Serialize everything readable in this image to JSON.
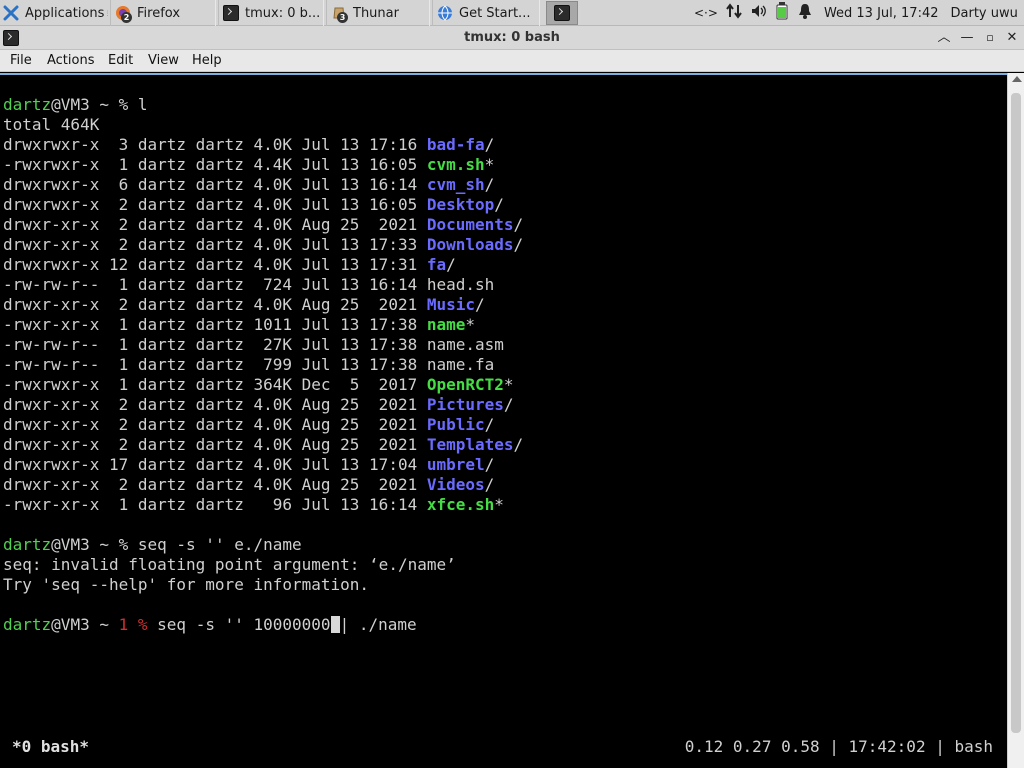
{
  "panel": {
    "applications_label": "Applications",
    "tasks": [
      {
        "label": "Firefox",
        "badge": "2"
      },
      {
        "label": "tmux: 0 b..."
      },
      {
        "label": "Thunar",
        "badge": "3"
      },
      {
        "label": "Get Start..."
      },
      {
        "label": ""
      }
    ],
    "tray": {
      "network_text": "<·>",
      "clock": "Wed 13 Jul, 17:42",
      "user": "Darty uwu"
    }
  },
  "window": {
    "title": "tmux: 0 bash"
  },
  "menubar": {
    "items": [
      "File",
      "Actions",
      "Edit",
      "View",
      "Help"
    ]
  },
  "terminal": {
    "prompt_user": "dartz",
    "prompt_host": "@VM3 ~ ",
    "cmd1": "% l",
    "total": "total 464K",
    "listing": [
      {
        "meta": "drwxrwxr-x  3 dartz dartz 4.0K Jul 13 17:16 ",
        "name": "bad-fa",
        "type": "dir",
        "suffix": "/"
      },
      {
        "meta": "-rwxrwxr-x  1 dartz dartz 4.4K Jul 13 16:05 ",
        "name": "cvm.sh",
        "type": "exe",
        "suffix": "*"
      },
      {
        "meta": "drwxrwxr-x  6 dartz dartz 4.0K Jul 13 16:14 ",
        "name": "cvm_sh",
        "type": "dir",
        "suffix": "/"
      },
      {
        "meta": "drwxrwxr-x  2 dartz dartz 4.0K Jul 13 16:05 ",
        "name": "Desktop",
        "type": "dir",
        "suffix": "/"
      },
      {
        "meta": "drwxr-xr-x  2 dartz dartz 4.0K Aug 25  2021 ",
        "name": "Documents",
        "type": "dir",
        "suffix": "/"
      },
      {
        "meta": "drwxr-xr-x  2 dartz dartz 4.0K Jul 13 17:33 ",
        "name": "Downloads",
        "type": "dir",
        "suffix": "/"
      },
      {
        "meta": "drwxrwxr-x 12 dartz dartz 4.0K Jul 13 17:31 ",
        "name": "fa",
        "type": "dir",
        "suffix": "/"
      },
      {
        "meta": "-rw-rw-r--  1 dartz dartz  724 Jul 13 16:14 ",
        "name": "head.sh",
        "type": "file",
        "suffix": ""
      },
      {
        "meta": "drwxr-xr-x  2 dartz dartz 4.0K Aug 25  2021 ",
        "name": "Music",
        "type": "dir",
        "suffix": "/"
      },
      {
        "meta": "-rwxr-xr-x  1 dartz dartz 1011 Jul 13 17:38 ",
        "name": "name",
        "type": "exe",
        "suffix": "*"
      },
      {
        "meta": "-rw-rw-r--  1 dartz dartz  27K Jul 13 17:38 ",
        "name": "name.asm",
        "type": "file",
        "suffix": ""
      },
      {
        "meta": "-rw-rw-r--  1 dartz dartz  799 Jul 13 17:38 ",
        "name": "name.fa",
        "type": "file",
        "suffix": ""
      },
      {
        "meta": "-rwxrwxr-x  1 dartz dartz 364K Dec  5  2017 ",
        "name": "OpenRCT2",
        "type": "exe",
        "suffix": "*"
      },
      {
        "meta": "drwxr-xr-x  2 dartz dartz 4.0K Aug 25  2021 ",
        "name": "Pictures",
        "type": "dir",
        "suffix": "/"
      },
      {
        "meta": "drwxr-xr-x  2 dartz dartz 4.0K Aug 25  2021 ",
        "name": "Public",
        "type": "dir",
        "suffix": "/"
      },
      {
        "meta": "drwxr-xr-x  2 dartz dartz 4.0K Aug 25  2021 ",
        "name": "Templates",
        "type": "dir",
        "suffix": "/"
      },
      {
        "meta": "drwxrwxr-x 17 dartz dartz 4.0K Jul 13 17:04 ",
        "name": "umbrel",
        "type": "dir",
        "suffix": "/"
      },
      {
        "meta": "drwxr-xr-x  2 dartz dartz 4.0K Aug 25  2021 ",
        "name": "Videos",
        "type": "dir",
        "suffix": "/"
      },
      {
        "meta": "-rwxr-xr-x  1 dartz dartz   96 Jul 13 16:14 ",
        "name": "xfce.sh",
        "type": "exe",
        "suffix": "*"
      }
    ],
    "cmd2": "% seq -s '' e./name",
    "err1": "seq: invalid floating point argument: ‘e./name’",
    "err2": "Try 'seq --help' for more information.",
    "exit_code": "1",
    "cmd3_symbol": "%",
    "cmd3_before_cursor": " seq -s '' 10000000",
    "cmd3_after_cursor": "| ./name",
    "status_left": "*0 bash*",
    "status_right": "0.12 0.27 0.58 | 17:42:02 | bash"
  },
  "colors": {
    "prompt_user": "#4fd24f",
    "directory": "#6b6bff",
    "executable": "#44dd44",
    "error_code": "#d03030",
    "focus_border": "#7ab0e0"
  },
  "icons": {
    "applications": "xfce-mouse-icon",
    "firefox": "firefox-icon",
    "terminal": "terminal-icon",
    "thunar": "file-manager-icon",
    "get_started": "globe-icon",
    "network": "network-arrows-icon",
    "volume": "volume-icon",
    "battery": "battery-icon",
    "notifications": "bell-icon"
  }
}
